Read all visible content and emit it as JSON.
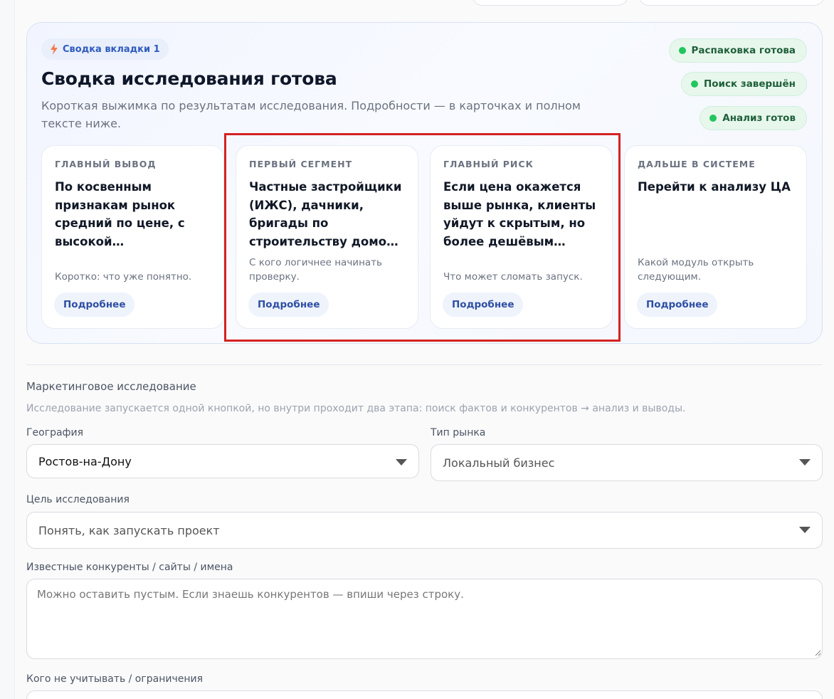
{
  "summary": {
    "tag": "Сводка вкладки 1",
    "title": "Сводка исследования готова",
    "subtitle": "Короткая выжимка по результатам исследования. Подробности — в карточках и полном тексте ниже.",
    "statuses": [
      "Распаковка готова",
      "Поиск завершён",
      "Анализ готов"
    ],
    "cards": [
      {
        "label": "ГЛАВНЫЙ ВЫВОД",
        "text": "По косвенным признакам рынок средний по цене, с высокой…",
        "note": "Коротко: что уже понятно.",
        "button": "Подробнее"
      },
      {
        "label": "ПЕРВЫЙ СЕГМЕНТ",
        "text": "Частные застройщики (ИЖС), дачники, бригады по строительству домо…",
        "note": "С кого логичнее начинать проверку.",
        "button": "Подробнее"
      },
      {
        "label": "ГЛАВНЫЙ РИСК",
        "text": "Если цена окажется выше рынка, клиенты уйдут к скрытым, но более дешёвым…",
        "note": "Что может сломать запуск.",
        "button": "Подробнее"
      },
      {
        "label": "ДАЛЬШЕ В СИСТЕМЕ",
        "text": "Перейти к анализу ЦА",
        "note": "Какой модуль открыть следующим.",
        "button": "Подробнее"
      }
    ]
  },
  "form": {
    "section_title": "Маркетинговое исследование",
    "section_hint": "Исследование запускается одной кнопкой, но внутри проходит два этапа: поиск фактов и конкурентов → анализ и выводы.",
    "geo_label": "География",
    "geo_value": "Ростов-на-Дону",
    "market_type_label": "Тип рынка",
    "market_type_value": "Локальный бизнес",
    "goal_label": "Цель исследования",
    "goal_value": "Понять, как запускать проект",
    "competitors_label": "Известные конкуренты / сайты / имена",
    "competitors_placeholder": "Можно оставить пустым. Если знаешь конкурентов — впиши через строку.",
    "exclusions_label": "Кого не учитывать / ограничения"
  },
  "colors": {
    "accent": "#2f5bbd",
    "status_green": "#22c55e",
    "highlight": "#d42222"
  },
  "icons": {
    "tag": "bolt-icon",
    "select": "caret-down-icon",
    "status": "status-dot-icon"
  }
}
